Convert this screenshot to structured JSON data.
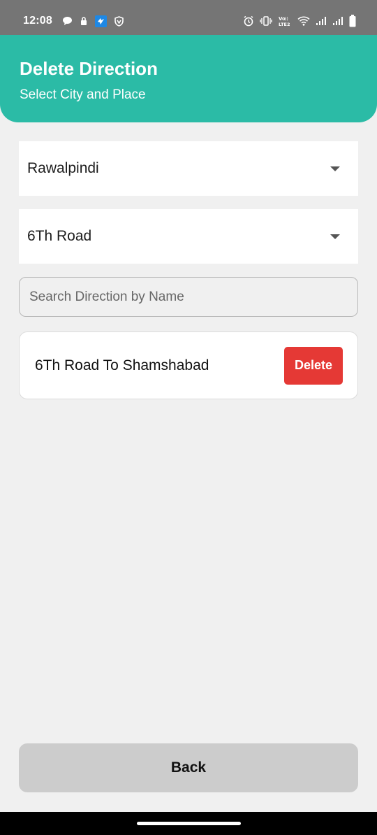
{
  "status_bar": {
    "time": "12:08",
    "left_icons": [
      "chat-bubble-icon",
      "sim-lock-icon",
      "app-notification-icon",
      "vpn-shield-icon"
    ],
    "right_icons": [
      "alarm-icon",
      "vibrate-icon",
      "volte-icon",
      "wifi-icon",
      "signal-icon",
      "signal-icon-2",
      "battery-icon"
    ],
    "volte_text": "VoLTE2"
  },
  "header": {
    "title": "Delete Direction",
    "subtitle": "Select City and Place",
    "color": "#2bbba6"
  },
  "city_dropdown": {
    "selected": "Rawalpindi"
  },
  "place_dropdown": {
    "selected": "6Th Road"
  },
  "search": {
    "placeholder": "Search Direction by Name",
    "value": ""
  },
  "directions": [
    {
      "name": "6Th Road To Shamshabad",
      "delete_label": "Delete"
    }
  ],
  "delete_color": "#e53935",
  "back_button": {
    "label": "Back"
  }
}
